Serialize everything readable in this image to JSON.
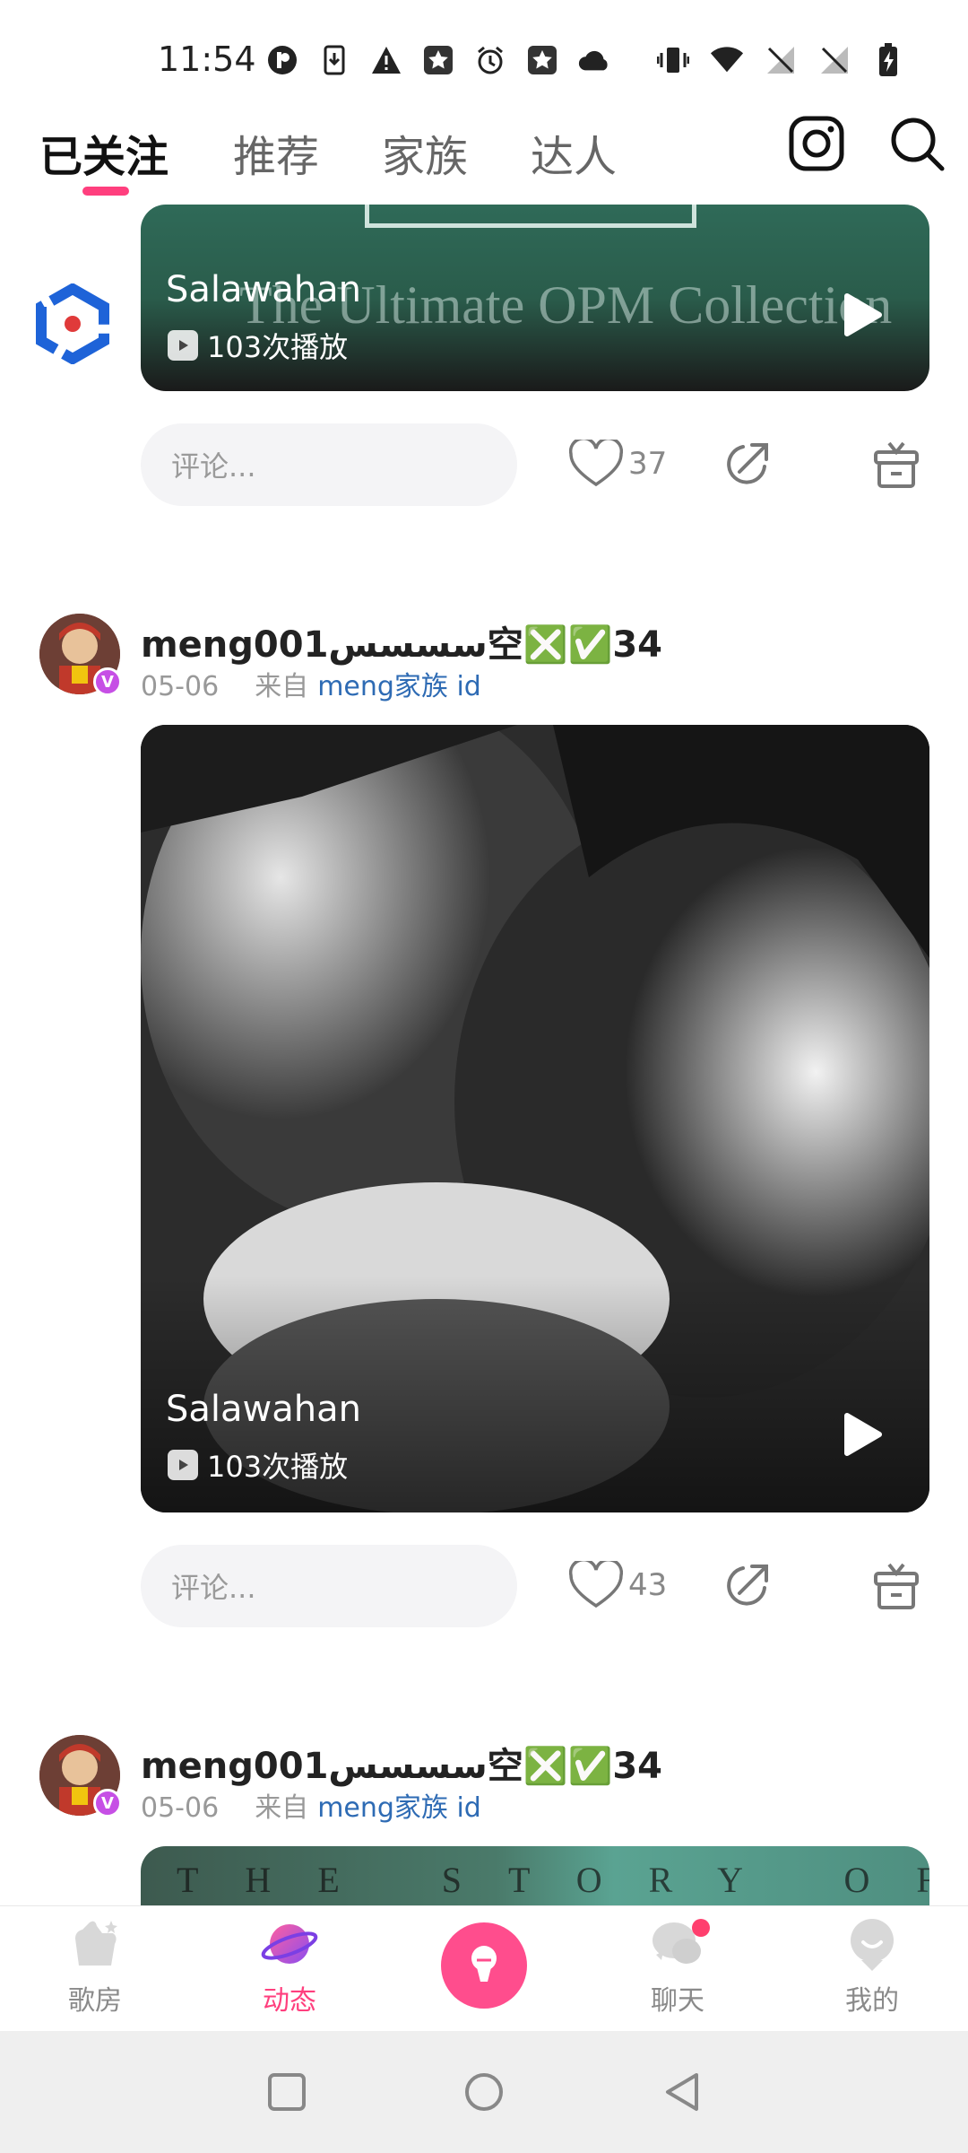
{
  "status_bar": {
    "time": "11:54",
    "left_icons": [
      "notification-p-icon",
      "download-icon",
      "warning-icon",
      "star-app-icon",
      "alarm-icon",
      "star-app-icon",
      "cloud-icon"
    ],
    "right_icons": [
      "vibrate-icon",
      "wifi-icon",
      "no-signal-icon",
      "no-signal-icon",
      "battery-charging-icon"
    ]
  },
  "tabs": [
    {
      "label": "已关注",
      "active": true
    },
    {
      "label": "推荐",
      "active": false
    },
    {
      "label": "家族",
      "active": false
    },
    {
      "label": "达人",
      "active": false
    }
  ],
  "colors": {
    "accent": "#ff3f7e",
    "link": "#2e6bb4"
  },
  "posts": [
    {
      "media": {
        "title": "Salawahan",
        "plays": "103次播放",
        "cover_text": "The Ultimate OPM Collection"
      },
      "comment_placeholder": "评论...",
      "likes": "37"
    },
    {
      "user": {
        "name": "meng001سسسس空❎✅34",
        "date": "05-06",
        "source_label": "来自",
        "family": "meng家族 id"
      },
      "media": {
        "title": "Salawahan",
        "plays": "103次播放"
      },
      "comment_placeholder": "评论...",
      "likes": "43"
    },
    {
      "user": {
        "name": "meng001سسسس空❎✅34",
        "date": "05-06",
        "source_label": "来自",
        "family": "meng家族 id"
      },
      "media": {
        "cover_text": "THE STORY OF"
      }
    }
  ],
  "bottom_nav": [
    {
      "label": "歌房",
      "icon": "song-room-icon",
      "active": false
    },
    {
      "label": "动态",
      "icon": "planet-icon",
      "active": true
    },
    {
      "label": "",
      "icon": "microphone-icon",
      "active": false
    },
    {
      "label": "聊天",
      "icon": "chat-icon",
      "active": false,
      "badge": true
    },
    {
      "label": "我的",
      "icon": "profile-icon",
      "active": false
    }
  ]
}
